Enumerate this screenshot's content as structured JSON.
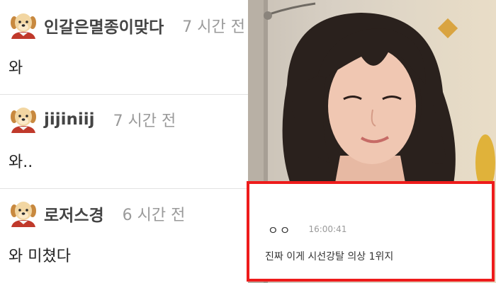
{
  "comments": [
    {
      "username": "인갈은멸종이맞다",
      "time": "7 시간 전",
      "text": "와"
    },
    {
      "username": "jijiniij",
      "time": "7 시간 전",
      "text": "와.."
    },
    {
      "username": "로저스경",
      "time": "6 시간 전",
      "text": "와 미쳤다"
    }
  ],
  "avatar_icon": "puppy-avatar-icon",
  "chat": {
    "username": "ㅇㅇ",
    "time": "16:00:41",
    "message": "진짜 이게 시선강탈 의상 1위지"
  },
  "colors": {
    "highlight_border": "#ee1b1b",
    "username_text": "#444444",
    "time_text": "#9a9a9a"
  }
}
